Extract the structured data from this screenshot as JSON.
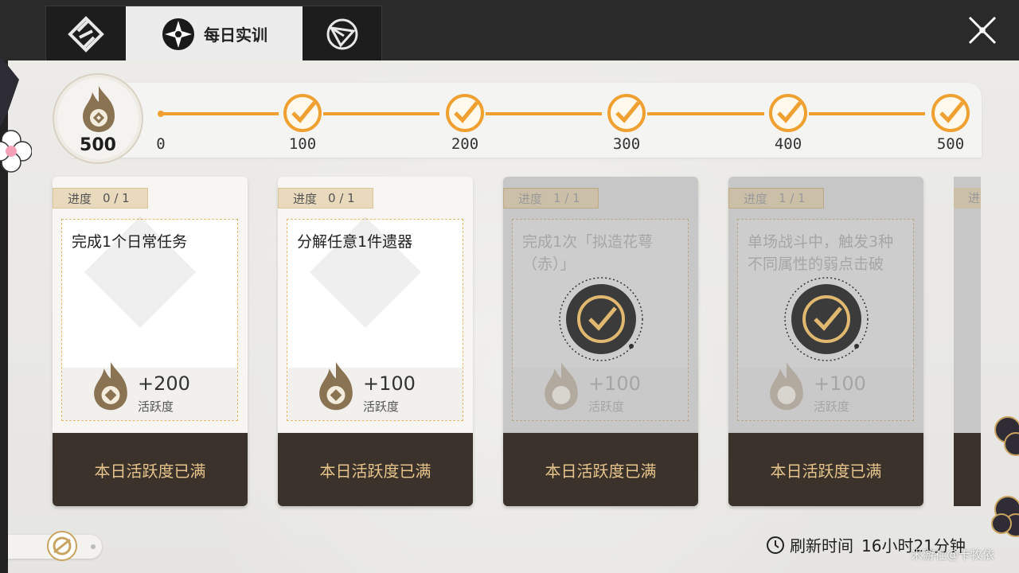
{
  "tabs": [
    {
      "name": "tab-logbook",
      "icon": "diamond-emblem-icon"
    },
    {
      "name": "tab-daily-training",
      "label": "每日实训",
      "icon": "compass-flower-icon",
      "active": true
    },
    {
      "name": "tab-navigation",
      "icon": "triangle-circle-icon"
    }
  ],
  "points": {
    "current": "500",
    "icon": "activity-flame-icon"
  },
  "milestones": [
    {
      "label": "0",
      "completed": false
    },
    {
      "label": "100",
      "completed": true
    },
    {
      "label": "200",
      "completed": true
    },
    {
      "label": "300",
      "completed": true
    },
    {
      "label": "400",
      "completed": true
    },
    {
      "label": "500",
      "completed": true
    }
  ],
  "progress_label": "进度",
  "cards": [
    {
      "progress": "0 / 1",
      "title": "完成1个日常任务",
      "reward": "+200",
      "reward_unit": "活跃度",
      "footer": "本日活跃度已满",
      "done": false
    },
    {
      "progress": "0 / 1",
      "title": "分解任意1件遗器",
      "reward": "+100",
      "reward_unit": "活跃度",
      "footer": "本日活跃度已满",
      "done": false
    },
    {
      "progress": "1 / 1",
      "title": "完成1次「拟造花萼（赤）」",
      "reward": "+100",
      "reward_unit": "活跃度",
      "footer": "本日活跃度已满",
      "done": true
    },
    {
      "progress": "1 / 1",
      "title": "单场战斗中，触发3种不同属性的弱点击破",
      "reward": "+100",
      "reward_unit": "活跃度",
      "footer": "本日活跃度已满",
      "done": true
    }
  ],
  "peek_card": {
    "progress_fragment": "进"
  },
  "refresh": {
    "label": "刷新时间",
    "value": "16小时21分钟",
    "icon": "clock-icon"
  },
  "watermark": "米游社@卡牧依",
  "colors": {
    "accent": "#f0a030",
    "footer_bg": "#3a322b",
    "footer_text": "#e7c48b"
  }
}
